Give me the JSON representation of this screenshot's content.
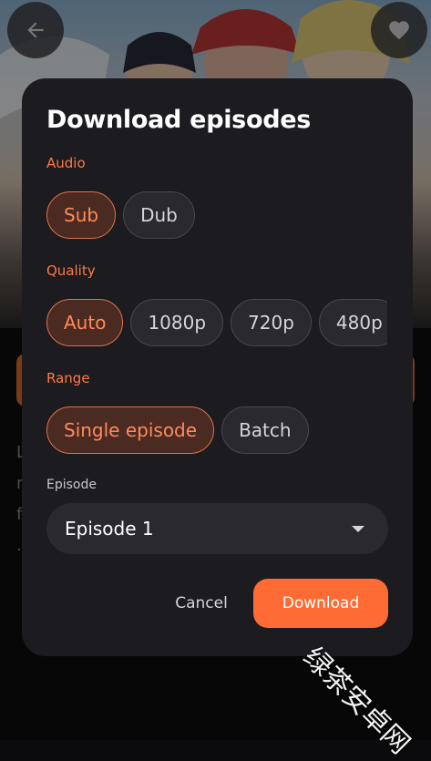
{
  "dialog": {
    "title": "Download episodes",
    "audio": {
      "label": "Audio",
      "options": [
        "Sub",
        "Dub"
      ],
      "selected": "Sub"
    },
    "quality": {
      "label": "Quality",
      "options": [
        "Auto",
        "1080p",
        "720p",
        "480p"
      ],
      "selected": "Auto"
    },
    "range": {
      "label": "Range",
      "options": [
        "Single episode",
        "Batch"
      ],
      "selected": "Single episode"
    },
    "episode": {
      "label": "Episode",
      "value": "Episode 1"
    },
    "cancel_label": "Cancel",
    "download_label": "Download"
  },
  "background": {
    "text_lines": [
      "L",
      "r",
      "f",
      "."
    ]
  },
  "watermark": "绿茶安卓网",
  "icons": {
    "back": "arrow-left-icon",
    "favorite": "heart-icon",
    "dropdown": "chevron-down-icon"
  },
  "colors": {
    "accent": "#ff6b35",
    "dialog_bg": "#1c1b20",
    "chip_bg": "#2a2930",
    "selected_chip_bg": "#4b2a22"
  }
}
